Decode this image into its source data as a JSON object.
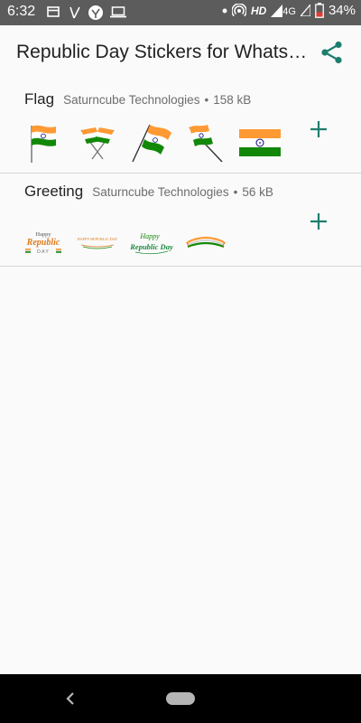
{
  "status_bar": {
    "time": "6:32",
    "hd": "HD",
    "network": "4G",
    "battery": "34%"
  },
  "app_bar": {
    "title": "Republic Day Stickers for WhatsApp",
    "share_icon": "share-icon"
  },
  "packs": [
    {
      "name": "Flag",
      "publisher": "Saturncube Technologies",
      "separator": "•",
      "size": "158 kB",
      "stickers": [
        "waving-flag",
        "crossed-flags",
        "flag-on-pole",
        "flag-on-stick",
        "flat-flag"
      ]
    },
    {
      "name": "Greeting",
      "publisher": "Saturncube Technologies",
      "separator": "•",
      "size": "56 kB",
      "stickers": [
        "happy-republic-day-text",
        "happy-republic-day-banner",
        "republic-day-script",
        "ribbon-banner"
      ]
    }
  ],
  "greeting_text": {
    "happy": "Happy",
    "republic": "Republic",
    "day": "DAY",
    "banner": "HAPPY REPUBLIC DAY",
    "script1": "Happy",
    "script2": "Republic Day"
  },
  "colors": {
    "saffron": "#FF9933",
    "green": "#138808",
    "navy": "#000080",
    "accent": "#1e7e6e"
  }
}
